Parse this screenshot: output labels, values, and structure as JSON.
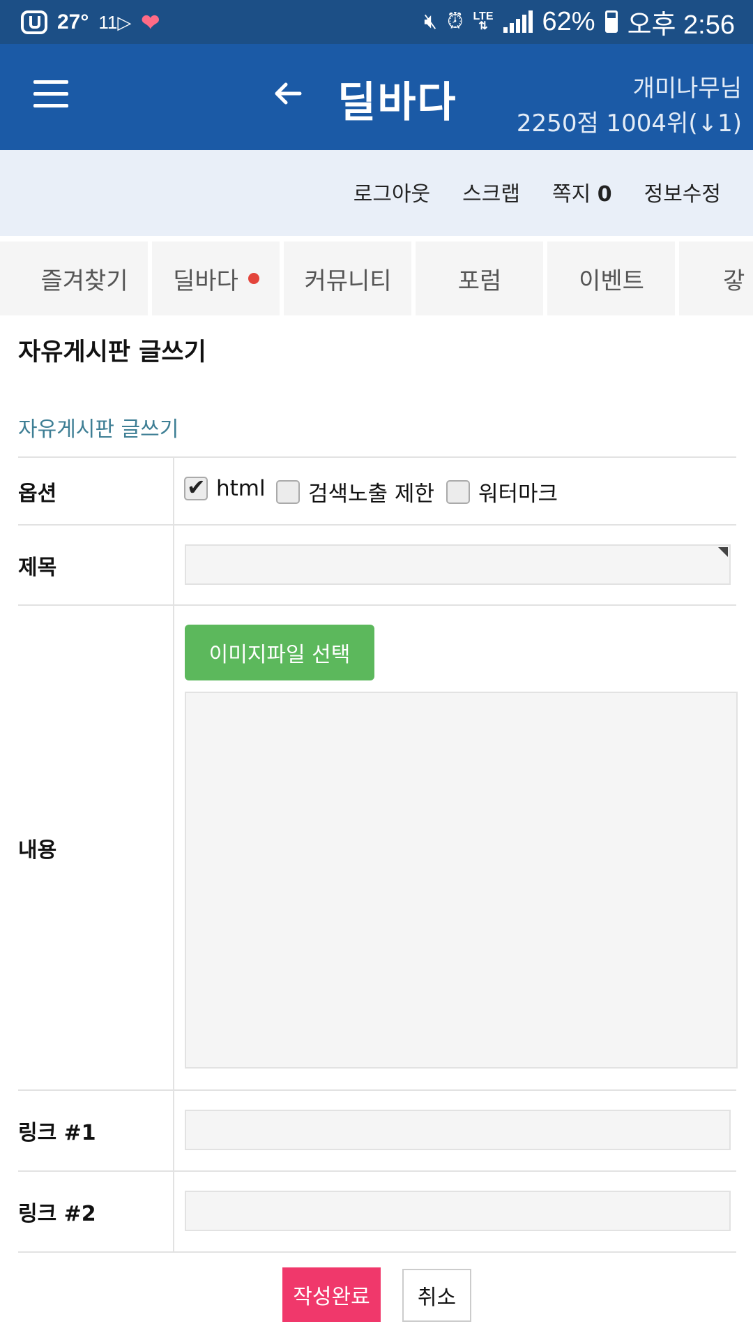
{
  "status_bar": {
    "temperature": "27°",
    "notification": "11▷",
    "network": "LTE",
    "battery": "62%",
    "time": "오후 2:56"
  },
  "header": {
    "menu_icon": "hamburger-icon",
    "back_icon": "arrow-left-icon",
    "title": "딜바다",
    "user_name": "개미나무님",
    "user_rank": "2250점 1004위(↓1)"
  },
  "user_links": {
    "logout": "로그아웃",
    "scrap": "스크랩",
    "message": "쪽지",
    "message_count": "0",
    "edit_profile": "정보수정"
  },
  "categories": [
    {
      "label": "즐겨찾기"
    },
    {
      "label": "딜바다"
    },
    {
      "label": "커뮤니티"
    },
    {
      "label": "포럼"
    },
    {
      "label": "이벤트"
    },
    {
      "label": "갛"
    }
  ],
  "page": {
    "title": "자유게시판 글쓰기",
    "caption": "자유게시판 글쓰기"
  },
  "form": {
    "options_label": "옵션",
    "option_html": "html",
    "option_html_checked": true,
    "option_noindex": "검색노출 제한",
    "option_noindex_checked": false,
    "option_watermark": "워터마크",
    "option_watermark_checked": false,
    "subject_label": "제목",
    "subject_value": "",
    "content_label": "내용",
    "upload_button": "이미지파일 선택",
    "content_value": "",
    "link1_label": "링크 #1",
    "link1_value": "",
    "link2_label": "링크 #2",
    "link2_value": ""
  },
  "actions": {
    "submit": "작성완료",
    "cancel": "취소"
  },
  "colors": {
    "status_bar": "#1c4f86",
    "header": "#1b5aa6",
    "subnav": "#e9eff8",
    "upload_button": "#5cb85c",
    "submit_button": "#f0386b",
    "caption": "#3d7e94",
    "notification_dot": "#e3443b"
  }
}
